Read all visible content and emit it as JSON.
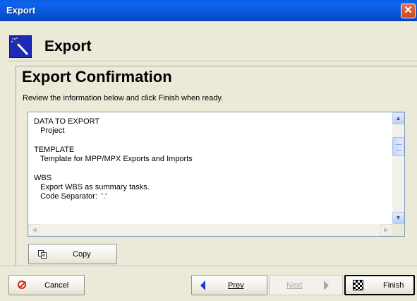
{
  "window": {
    "title": "Export",
    "close_label": "✕"
  },
  "header": {
    "title": "Export",
    "icon": "magic-wand-icon"
  },
  "page": {
    "title": "Export Confirmation",
    "instruction": "Review the information below and click Finish when ready."
  },
  "summary": {
    "text": "DATA TO EXPORT\n   Project\n\nTEMPLATE\n   Template for MPP/MPX Exports and Imports\n\nWBS\n   Export WBS as summary tasks.\n   Code Separator:  '.'"
  },
  "buttons": {
    "copy_label": "Copy",
    "cancel_label": "Cancel",
    "prev_label": "Prev",
    "next_label": "Next",
    "finish_label": "Finish"
  },
  "colors": {
    "titlebar": "#0A5FE3",
    "background": "#ECE9D8",
    "accent_wizard": "#1C2AB6",
    "cancel_icon": "#D7261C"
  }
}
